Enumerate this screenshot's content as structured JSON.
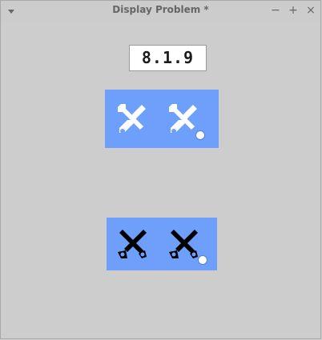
{
  "window": {
    "title": "Display Problem *",
    "controls": {
      "menu": "▾",
      "minimize": "−",
      "maximize": "+",
      "close": "×"
    }
  },
  "version": {
    "text": "8.1.9"
  },
  "panels": {
    "top": {
      "background": "#6d9ffb",
      "icon_color": "#ffffff",
      "icons": [
        "tools-icon",
        "tools-with-badge-icon"
      ]
    },
    "bottom": {
      "background": "#6d9ffb",
      "icon_color": "#000000",
      "icons": [
        "tools-icon",
        "tools-with-badge-icon"
      ]
    }
  }
}
